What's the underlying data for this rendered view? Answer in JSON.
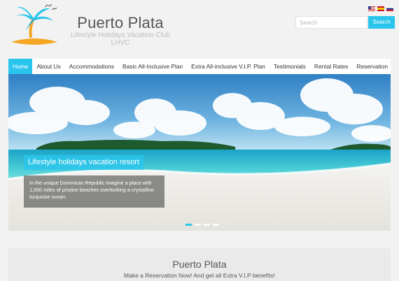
{
  "brand": {
    "title": "Puerto Plata",
    "subtitle_line1": "Lifestyle Holidays Vacation Club",
    "subtitle_line2": "LHVC",
    "logo_icon": "palm-tree-island-icon"
  },
  "languages": [
    "us-flag",
    "spain-flag",
    "russia-flag"
  ],
  "search": {
    "placeholder": "Search",
    "button_label": "Search"
  },
  "nav": {
    "items": [
      {
        "label": "Home",
        "active": true
      },
      {
        "label": "About Us"
      },
      {
        "label": "Accommodations"
      },
      {
        "label": "Basic All-Inclusive Plan"
      },
      {
        "label": "Extra All-inclusive V.I.P. Plan"
      },
      {
        "label": "Testimonials"
      },
      {
        "label": "Rental Rates"
      },
      {
        "label": "Reservation"
      }
    ]
  },
  "hero": {
    "caption_title": "Lifestyle holidays vacation resort",
    "caption_text": "In the unique Dominican Republic imagine a place with 1,000 miles of pristine beaches overlooking a crystalline turquoise ocean.",
    "slides_total": 4,
    "slide_active": 1
  },
  "promo": {
    "title": "Puerto Plata",
    "subtitle": "Make a Reservation Now! And get all Extra V.I.P benefits!"
  },
  "colors": {
    "accent": "#29c5ec",
    "background": "#f2f2f2",
    "nav_bg": "#ffffff"
  }
}
